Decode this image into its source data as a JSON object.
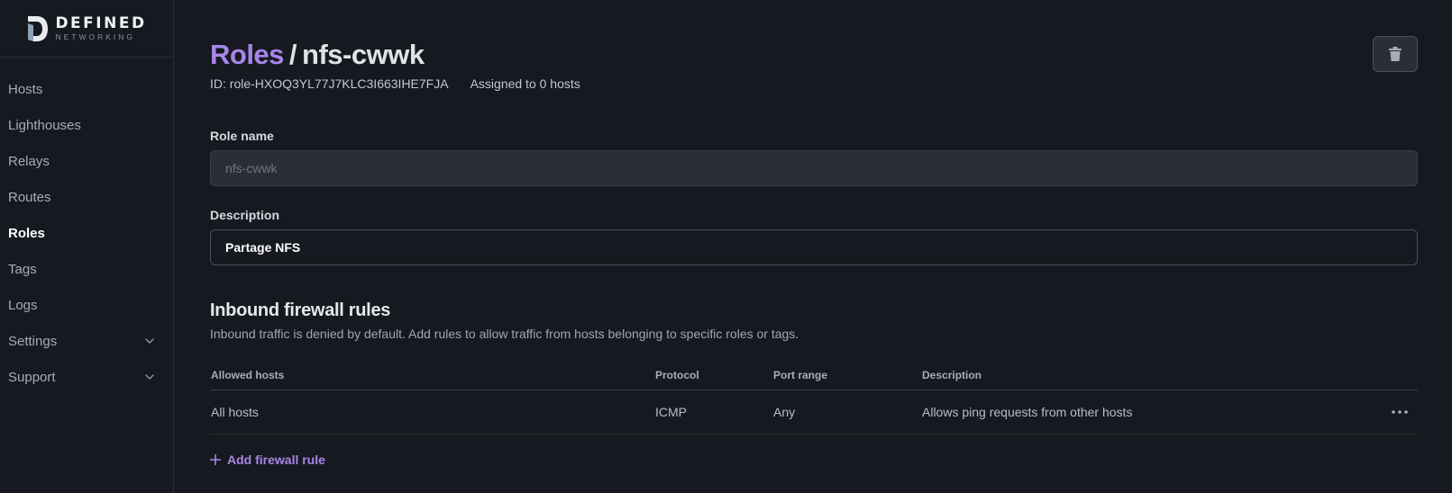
{
  "brand": {
    "title": "DEFINED",
    "subtitle": "NETWORKING"
  },
  "sidebar": {
    "items": [
      {
        "label": "Hosts"
      },
      {
        "label": "Lighthouses"
      },
      {
        "label": "Relays"
      },
      {
        "label": "Routes"
      },
      {
        "label": "Roles",
        "active": true
      },
      {
        "label": "Tags"
      },
      {
        "label": "Logs"
      },
      {
        "label": "Settings",
        "icon": "chevron-down-icon"
      },
      {
        "label": "Support",
        "icon": "chevron-down-icon"
      }
    ]
  },
  "header": {
    "breadcrumb_link": "Roles",
    "separator": "/",
    "current": "nfs-cwwk",
    "id_text": "ID: role-HXOQ3YL77J7KLC3I663IHE7FJA",
    "assigned_text": "Assigned to 0 hosts",
    "delete_icon": "trash-icon"
  },
  "form": {
    "role_name_label": "Role name",
    "role_name_value": "nfs-cwwk",
    "description_label": "Description",
    "description_value": "Partage NFS"
  },
  "firewall": {
    "title": "Inbound firewall rules",
    "subtitle": "Inbound traffic is denied by default. Add rules to allow traffic from hosts belonging to specific roles or tags.",
    "columns": {
      "allowed_hosts": "Allowed hosts",
      "protocol": "Protocol",
      "port_range": "Port range",
      "description": "Description"
    },
    "rows": [
      {
        "allowed_hosts": "All hosts",
        "protocol": "ICMP",
        "port_range": "Any",
        "description": "Allows ping requests from other hosts",
        "menu_icon": "more-horizontal-icon"
      }
    ],
    "add_rule_label": "Add firewall rule",
    "add_rule_icon": "plus-icon"
  },
  "colors": {
    "accent": "#a985e8",
    "background": "#16191f",
    "border": "#2b2f37"
  }
}
